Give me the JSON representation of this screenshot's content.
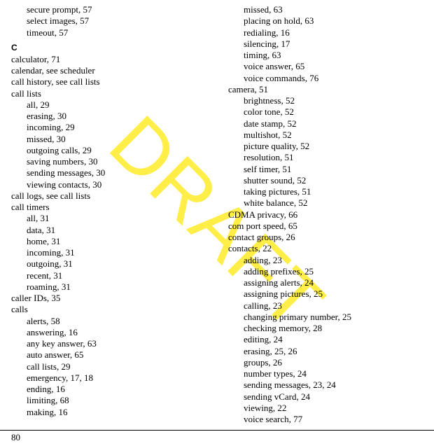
{
  "watermark": "DRAFT",
  "page_number": "80",
  "columns": [
    [
      {
        "type": "sub",
        "text": "secure prompt, 57"
      },
      {
        "type": "sub",
        "text": "select images, 57"
      },
      {
        "type": "sub",
        "text": "timeout, 57"
      },
      {
        "type": "letter",
        "text": "C"
      },
      {
        "type": "top",
        "text": "calculator, 71"
      },
      {
        "type": "top",
        "text": "calendar, see scheduler"
      },
      {
        "type": "top",
        "text": "call history, see call lists"
      },
      {
        "type": "top",
        "text": "call lists"
      },
      {
        "type": "sub",
        "text": "all, 29"
      },
      {
        "type": "sub",
        "text": "erasing, 30"
      },
      {
        "type": "sub",
        "text": "incoming, 29"
      },
      {
        "type": "sub",
        "text": "missed, 30"
      },
      {
        "type": "sub",
        "text": "outgoing calls, 29"
      },
      {
        "type": "sub",
        "text": "saving numbers, 30"
      },
      {
        "type": "sub",
        "text": "sending messages, 30"
      },
      {
        "type": "sub",
        "text": "viewing contacts, 30"
      },
      {
        "type": "top",
        "text": "call logs, see call lists"
      },
      {
        "type": "top",
        "text": "call timers"
      },
      {
        "type": "sub",
        "text": "all, 31"
      },
      {
        "type": "sub",
        "text": "data, 31"
      },
      {
        "type": "sub",
        "text": "home, 31"
      },
      {
        "type": "sub",
        "text": "incoming, 31"
      },
      {
        "type": "sub",
        "text": "outgoing, 31"
      },
      {
        "type": "sub",
        "text": "recent, 31"
      },
      {
        "type": "sub",
        "text": "roaming, 31"
      },
      {
        "type": "top",
        "text": "caller IDs, 35"
      },
      {
        "type": "top",
        "text": "calls"
      },
      {
        "type": "sub",
        "text": "alerts, 58"
      },
      {
        "type": "sub",
        "text": "answering, 16"
      },
      {
        "type": "sub",
        "text": "any key answer, 63"
      },
      {
        "type": "sub",
        "text": "auto answer, 65"
      },
      {
        "type": "sub",
        "text": "call lists, 29"
      },
      {
        "type": "sub",
        "text": "emergency, 17, 18"
      },
      {
        "type": "sub",
        "text": "ending, 16"
      },
      {
        "type": "sub",
        "text": "limiting, 68"
      },
      {
        "type": "sub",
        "text": "making, 16"
      }
    ],
    [
      {
        "type": "sub",
        "text": "missed, 63"
      },
      {
        "type": "sub",
        "text": "placing on hold, 63"
      },
      {
        "type": "sub",
        "text": "redialing, 16"
      },
      {
        "type": "sub",
        "text": "silencing, 17"
      },
      {
        "type": "sub",
        "text": "timing, 63"
      },
      {
        "type": "sub",
        "text": "voice answer, 65"
      },
      {
        "type": "sub",
        "text": "voice commands, 76"
      },
      {
        "type": "top",
        "text": "camera, 51"
      },
      {
        "type": "sub",
        "text": "brightness, 52"
      },
      {
        "type": "sub",
        "text": "color tone, 52"
      },
      {
        "type": "sub",
        "text": "date stamp, 52"
      },
      {
        "type": "sub",
        "text": "multishot, 52"
      },
      {
        "type": "sub",
        "text": "picture quality, 52"
      },
      {
        "type": "sub",
        "text": "resolution, 51"
      },
      {
        "type": "sub",
        "text": "self timer, 51"
      },
      {
        "type": "sub",
        "text": "shutter sound, 52"
      },
      {
        "type": "sub",
        "text": "taking pictures, 51"
      },
      {
        "type": "sub",
        "text": "white balance, 52"
      },
      {
        "type": "top",
        "text": "CDMA privacy, 66"
      },
      {
        "type": "top",
        "text": "com port speed, 65"
      },
      {
        "type": "top",
        "text": "contact groups, 26"
      },
      {
        "type": "top",
        "text": "contacts, 22"
      },
      {
        "type": "sub",
        "text": "adding, 23"
      },
      {
        "type": "sub",
        "text": "adding prefixes, 25"
      },
      {
        "type": "sub",
        "text": "assigning alerts, 24"
      },
      {
        "type": "sub",
        "text": "assigning pictures, 25"
      },
      {
        "type": "sub",
        "text": "calling, 23"
      },
      {
        "type": "sub",
        "text": "changing primary number, 25"
      },
      {
        "type": "sub",
        "text": "checking memory, 28"
      },
      {
        "type": "sub",
        "text": "editing, 24"
      },
      {
        "type": "sub",
        "text": "erasing, 25, 26"
      },
      {
        "type": "sub",
        "text": "groups, 26"
      },
      {
        "type": "sub",
        "text": "number types, 24"
      },
      {
        "type": "sub",
        "text": "sending messages, 23, 24"
      },
      {
        "type": "sub",
        "text": "sending vCard, 24"
      },
      {
        "type": "sub",
        "text": "viewing, 22"
      },
      {
        "type": "sub",
        "text": "voice search, 77"
      }
    ]
  ]
}
